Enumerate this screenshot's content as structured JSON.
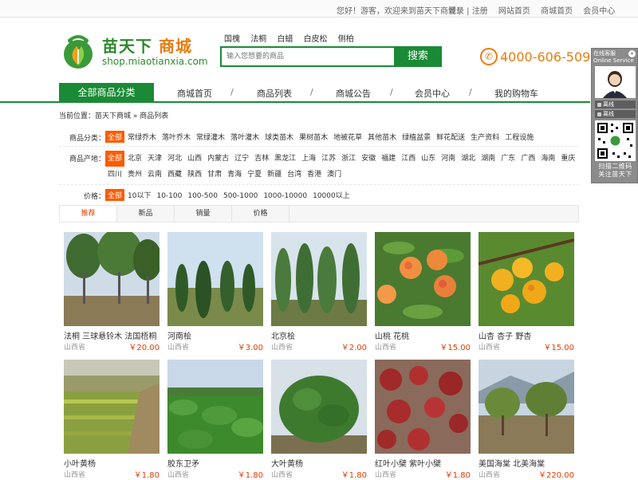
{
  "topbar": {
    "welcome": "您好！游客，欢迎来到苗天下商城！",
    "links": [
      "登录 | 注册",
      "网站首页",
      "商城首页",
      "会员中心"
    ]
  },
  "logo": {
    "name_green": "苗天下",
    "name_orange": "商城",
    "url": "shop.miaotianxia.com"
  },
  "hot_words": [
    "国槐",
    "法桐",
    "白蜡",
    "白皮松",
    "侧柏"
  ],
  "search": {
    "placeholder": "输入您想要的商品",
    "button": "搜索"
  },
  "phone": {
    "number": "4000-606-509",
    "icon": "phone-icon"
  },
  "nav": {
    "all_categories": "全部商品分类",
    "items": [
      "商城首页",
      "商品列表",
      "商城公告",
      "会员中心",
      "我的购物车"
    ]
  },
  "breadcrumb": {
    "prefix": "当前位置：",
    "home": "苗天下商城",
    "sep": "»",
    "current": "商品列表"
  },
  "filters": {
    "category": {
      "label": "商品分类：",
      "options": [
        "全部",
        "常绿乔木",
        "落叶乔木",
        "常绿灌木",
        "落叶灌木",
        "球类苗木",
        "果树苗木",
        "地被花草",
        "其他苗木",
        "绿植盆景",
        "鲜花配送",
        "生产资料",
        "工程设施"
      ]
    },
    "origin": {
      "label": "商品产地：",
      "options": [
        "全部",
        "北京",
        "天津",
        "河北",
        "山西",
        "内蒙古",
        "辽宁",
        "吉林",
        "黑龙江",
        "上海",
        "江苏",
        "浙江",
        "安徽",
        "福建",
        "江西",
        "山东",
        "河南",
        "湖北",
        "湖南",
        "广东",
        "广西",
        "海南",
        "重庆",
        "四川",
        "贵州",
        "云南",
        "西藏",
        "陕西",
        "甘肃",
        "青海",
        "宁夏",
        "新疆",
        "台湾",
        "香港",
        "澳门"
      ]
    },
    "price": {
      "label": "价格：",
      "options": [
        "全部",
        "10以下",
        "10-100",
        "100-500",
        "500-1000",
        "1000-10000",
        "10000以上"
      ]
    }
  },
  "sort_tabs": [
    "推荐",
    "新品",
    "销量",
    "价格"
  ],
  "products": [
    {
      "name": "法桐 三球悬铃木 法国梧桐",
      "location": "山西省",
      "price": "￥20.00"
    },
    {
      "name": "河南桧",
      "location": "山西省",
      "price": "￥3.00"
    },
    {
      "name": "北京桧",
      "location": "山西省",
      "price": "￥2.00"
    },
    {
      "name": "山桃 花桃",
      "location": "山西省",
      "price": "￥15.00"
    },
    {
      "name": "山杏 杏子 野杏",
      "location": "山西省",
      "price": "￥15.00"
    },
    {
      "name": "小叶黄杨",
      "location": "山西省",
      "price": "￥1.80"
    },
    {
      "name": "胶东卫矛",
      "location": "山西省",
      "price": "￥1.80"
    },
    {
      "name": "大叶黄杨",
      "location": "山西省",
      "price": "￥1.80"
    },
    {
      "name": "红叶小檗 紫叶小檗",
      "location": "山西省",
      "price": "￥1.80"
    },
    {
      "name": "美国海棠 北美海棠",
      "location": "山西省",
      "price": "￥220.00"
    }
  ],
  "service_panel": {
    "title_cn": "在线客服",
    "title_en": "Online Service",
    "statuses": [
      "离线",
      "离线"
    ],
    "footer_lines": [
      "扫描二维码",
      "关注苗天下"
    ]
  },
  "colors": {
    "brand_green": "#1a8a35",
    "accent_orange": "#e97c10",
    "price_red": "#e63c00",
    "filter_active": "#ff5a00"
  }
}
